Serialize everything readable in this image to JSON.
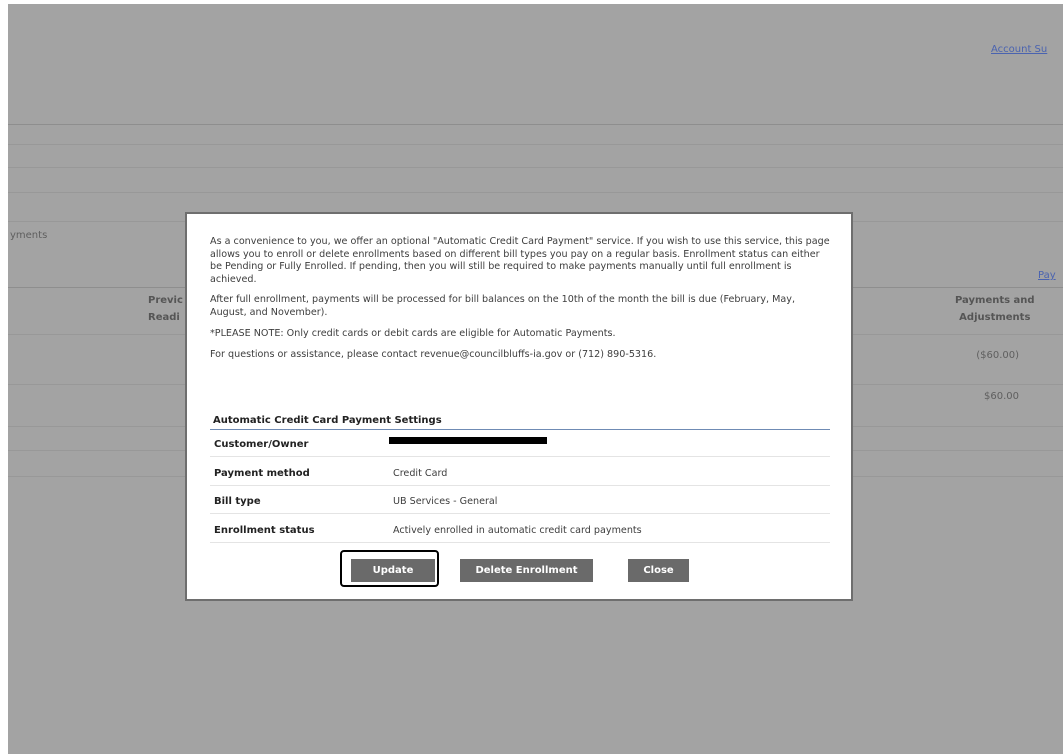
{
  "background": {
    "account_link": "Account Su",
    "payments_tab": "yments",
    "pay_link": "Pay",
    "col_previous": [
      "Previc",
      "Readi"
    ],
    "col_payments": [
      "Payments and",
      "Adjustments"
    ],
    "amounts": [
      "($60.00)",
      "$60.00"
    ]
  },
  "modal": {
    "paragraphs": [
      "As a convenience to you, we offer an optional \"Automatic Credit Card Payment\" service. If you wish to use this service, this page allows you to enroll or delete enrollments based on different bill types you pay on a regular basis. Enrollment status can either be Pending or Fully Enrolled. If pending, then you will still be required to make payments manually until full enrollment is achieved.",
      "After full enrollment, payments will be processed for bill balances on the 10th of the month the bill is due (February, May, August, and November).",
      "*PLEASE NOTE: Only credit cards or debit cards are eligible for Automatic Payments.",
      "For questions or assistance, please contact revenue@councilbluffs-ia.gov or (712) 890-5316."
    ],
    "settings_title": "Automatic Credit Card Payment Settings",
    "rows": [
      {
        "label": "Customer/Owner",
        "value": ""
      },
      {
        "label": "Payment method",
        "value": "Credit Card"
      },
      {
        "label": "Bill type",
        "value": "UB Services - General"
      },
      {
        "label": "Enrollment status",
        "value": "Actively enrolled in automatic credit card payments"
      }
    ],
    "buttons": {
      "update": "Update",
      "delete": "Delete Enrollment",
      "close": "Close"
    }
  },
  "colors": {
    "overlay": "#a3a3a3",
    "button": "#6a6a6a",
    "link": "#4a63b0",
    "rule": "#6f8bb4"
  }
}
